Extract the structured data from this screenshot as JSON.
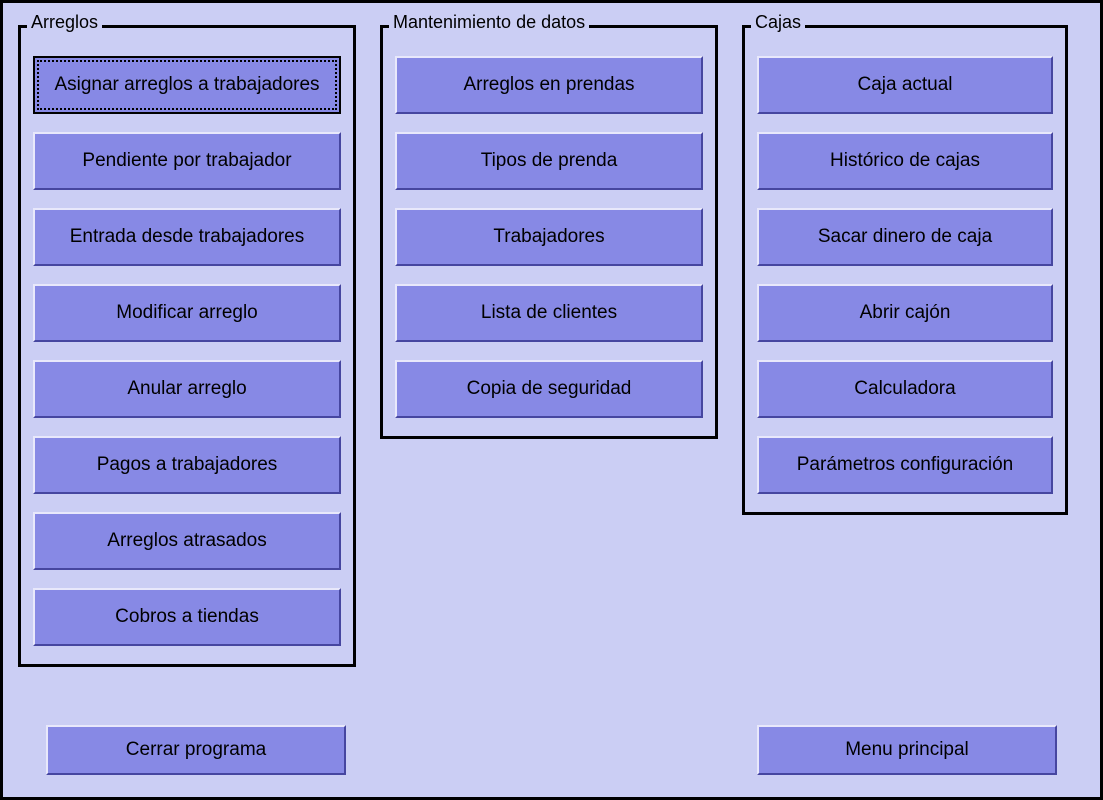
{
  "groups": {
    "arreglos": {
      "title": "Arreglos",
      "buttons": [
        "Asignar arreglos a trabajadores",
        "Pendiente por trabajador",
        "Entrada desde trabajadores",
        "Modificar arreglo",
        "Anular arreglo",
        "Pagos a trabajadores",
        "Arreglos atrasados",
        "Cobros a tiendas"
      ]
    },
    "mantenimiento": {
      "title": "Mantenimiento de datos",
      "buttons": [
        "Arreglos en prendas",
        "Tipos de prenda",
        "Trabajadores",
        "Lista de clientes",
        "Copia de seguridad"
      ]
    },
    "cajas": {
      "title": "Cajas",
      "buttons": [
        "Caja actual",
        "Histórico de cajas",
        "Sacar dinero de caja",
        "Abrir cajón",
        "Calculadora",
        "Parámetros configuración"
      ]
    }
  },
  "bottom": {
    "close": "Cerrar programa",
    "main_menu": "Menu principal"
  }
}
